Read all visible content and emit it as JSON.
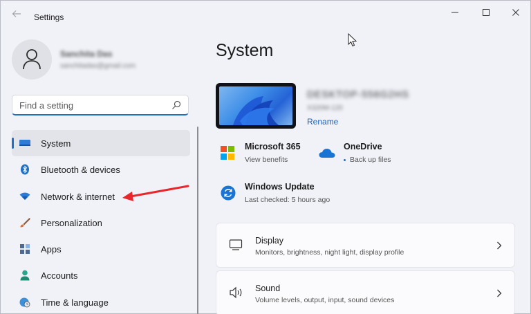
{
  "window": {
    "title": "Settings",
    "back_icon": "back-arrow-icon",
    "controls": [
      "minimize-icon",
      "maximize-icon",
      "close-icon"
    ]
  },
  "user": {
    "name": "Sanchita Das",
    "email": "sanchitadas@gmail.com"
  },
  "search": {
    "placeholder": "Find a setting",
    "value": ""
  },
  "sidebar": {
    "items": [
      {
        "label": "System",
        "icon": "monitor-icon",
        "active": true
      },
      {
        "label": "Bluetooth & devices",
        "icon": "bluetooth-icon",
        "active": false
      },
      {
        "label": "Network & internet",
        "icon": "wifi-icon",
        "active": false
      },
      {
        "label": "Personalization",
        "icon": "brush-icon",
        "active": false
      },
      {
        "label": "Apps",
        "icon": "apps-icon",
        "active": false
      },
      {
        "label": "Accounts",
        "icon": "person-icon",
        "active": false
      },
      {
        "label": "Time & language",
        "icon": "globe-clock-icon",
        "active": false
      }
    ]
  },
  "main": {
    "title": "System",
    "device": {
      "name": "DESKTOP-556G2HS",
      "model": "X320M-120",
      "rename_label": "Rename"
    },
    "tiles": [
      {
        "title": "Microsoft 365",
        "subtitle": "View benefits",
        "icon": "microsoft-logo-icon"
      },
      {
        "title": "OneDrive",
        "subtitle": "Back up files",
        "icon": "cloud-icon"
      },
      {
        "title": "Windows Update",
        "subtitle": "Last checked: 5 hours ago",
        "icon": "refresh-icon"
      }
    ],
    "cards": [
      {
        "title": "Display",
        "subtitle": "Monitors, brightness, night light, display profile",
        "icon": "display-icon"
      },
      {
        "title": "Sound",
        "subtitle": "Volume levels, output, input, sound devices",
        "icon": "speaker-icon"
      }
    ]
  },
  "colors": {
    "accent": "#1f6fc5",
    "annotation_arrow": "#e8262b",
    "background": "#f0f2f8",
    "card": "#fbfbfd"
  }
}
